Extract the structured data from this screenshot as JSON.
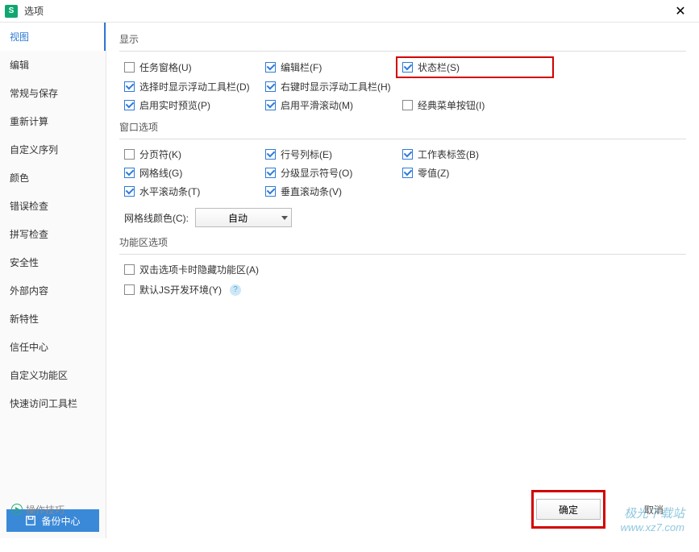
{
  "titlebar": {
    "app_letter": "S",
    "title": "选项"
  },
  "sidebar": {
    "items": [
      "视图",
      "编辑",
      "常规与保存",
      "重新计算",
      "自定义序列",
      "颜色",
      "错误检查",
      "拼写检查",
      "安全性",
      "外部内容",
      "新特性",
      "信任中心",
      "自定义功能区",
      "快速访问工具栏"
    ],
    "backup": "备份中心",
    "tips": "操作技巧"
  },
  "display": {
    "title": "显示",
    "task_pane": "任务窗格(U)",
    "edit_bar": "编辑栏(F)",
    "status_bar": "状态栏(S)",
    "float_select": "选择时显示浮动工具栏(D)",
    "float_right": "右键时显示浮动工具栏(H)",
    "realtime_preview": "启用实时预览(P)",
    "smooth_scroll": "启用平滑滚动(M)",
    "classic_menu": "经典菜单按钮(I)"
  },
  "window": {
    "title": "窗口选项",
    "page_break": "分页符(K)",
    "row_col_header": "行号列标(E)",
    "sheet_tabs": "工作表标签(B)",
    "gridlines": "网格线(G)",
    "outline_symbols": "分级显示符号(O)",
    "zero_values": "零值(Z)",
    "h_scroll": "水平滚动条(T)",
    "v_scroll": "垂直滚动条(V)",
    "grid_color_label": "网格线颜色(C):",
    "grid_color_value": "自动"
  },
  "ribbon": {
    "title": "功能区选项",
    "hide_on_dblclick": "双击选项卡时隐藏功能区(A)",
    "default_js": "默认JS开发环境(Y)"
  },
  "buttons": {
    "ok": "确定",
    "cancel": "取消"
  },
  "watermark": {
    "cn": "极光下载站",
    "url": "www.xz7.com"
  }
}
